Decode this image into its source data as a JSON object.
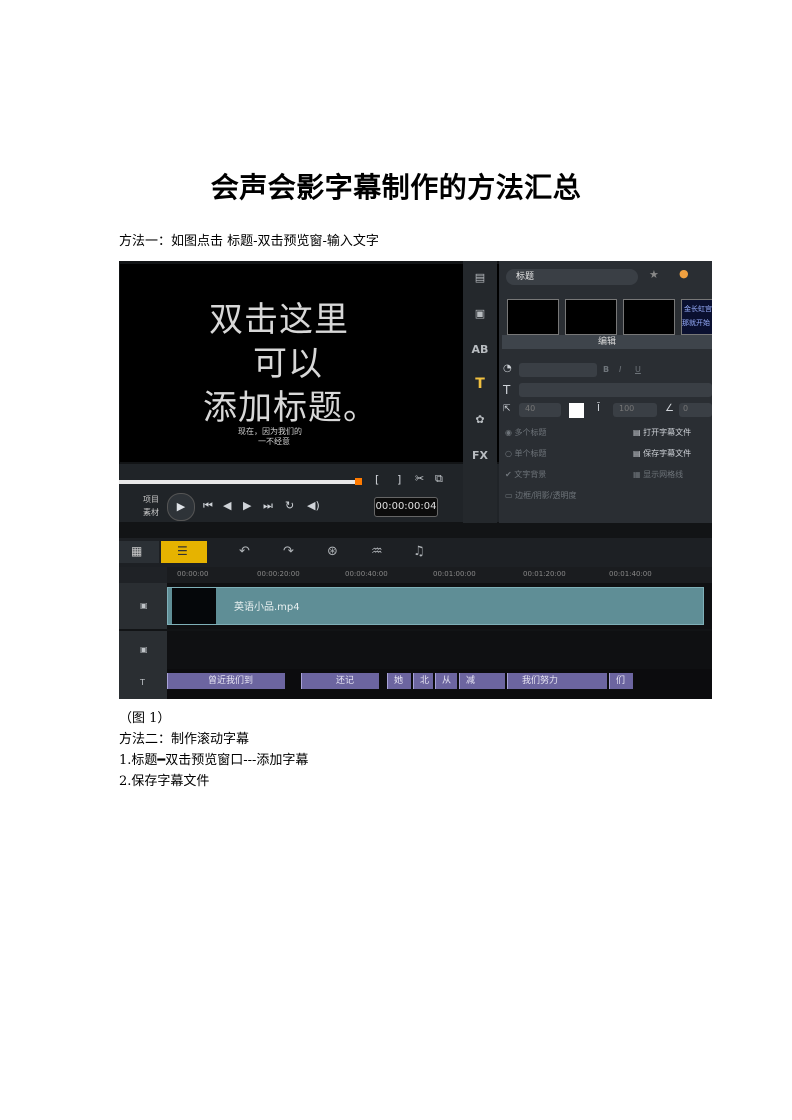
{
  "document": {
    "title": "会声会影字幕制作的方法汇总",
    "method1": "方法一：如图点击 标题-双击预览窗-输入文字",
    "caption": "（图 1）",
    "method2": "方法二：制作滚动字幕",
    "step1": "1.标题━双击预览窗口---添加字幕",
    "step2": "2.保存字幕文件"
  },
  "screenshot": {
    "preview": {
      "line1": "双击这里",
      "line2": "可以",
      "line3": "添加标题。",
      "small1": "现在，因为我们的",
      "small2": "一不经意",
      "label_project": "项目",
      "label_clip": "素材",
      "timecode": "00:00:00:04"
    },
    "panel": {
      "dropdown": "标题",
      "edit_tab": "编辑",
      "thumb4_line1": "金长虹宫",
      "thumb4_line2": "那就开始",
      "size_value": "40",
      "spacing_value": "100",
      "angle_value": "0",
      "opt_multi": "多个标题",
      "opt_single": "单个标题",
      "opt_bg": "文字背景",
      "opt_border": "边框/阴影/透明度",
      "open_sub": "打开字幕文件",
      "save_sub": "保存字幕文件",
      "save_motion": "显示网格线"
    },
    "ruler": [
      "00:00:00",
      "00:00:20:00",
      "00:00:40:00",
      "00:01:00:00",
      "00:01:20:00",
      "00:01:40:00"
    ],
    "video_clip": "英语小品.mp4",
    "title_clips": [
      "曾近我们到",
      "还记",
      "她",
      "北",
      "从",
      "减",
      "我们努力",
      "们"
    ]
  },
  "colors": {
    "video_clip": "#5f8e96",
    "title_clip": "#6c65a0",
    "accent": "#ff7a00"
  }
}
